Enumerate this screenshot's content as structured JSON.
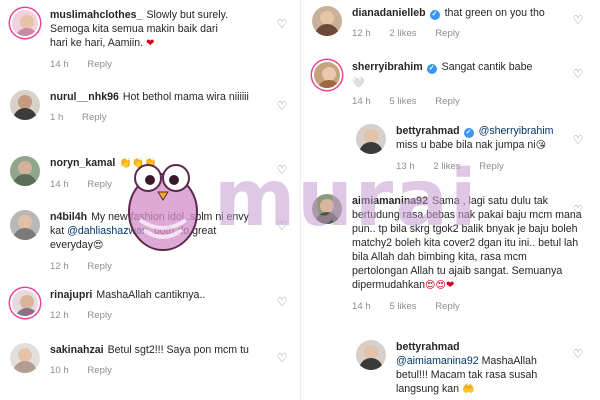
{
  "left_comments": [
    {
      "username": "muslimahclothes_",
      "text": "Slowly but surely. Semoga kita semua makin baik dari hari ke hari, Aamiin.",
      "emoji": "❤",
      "time": "14 h",
      "reply_label": "Reply"
    },
    {
      "username": "nurul__nhk96",
      "text": "Hot bethol mama wira niiiiii",
      "time": "1 h",
      "reply_label": "Reply"
    },
    {
      "username": "noryn_kamal",
      "text": "",
      "emoji": "👏👏👏",
      "time": "14 h",
      "reply_label": "Reply"
    },
    {
      "username": "n4bil4h",
      "text_before": "My new fashion idol..sblm ni envy kat",
      "mention": "@dahliashazwan",
      "text_after": "..both do great everyday",
      "emoji": "😍",
      "time": "12 h",
      "reply_label": "Reply"
    },
    {
      "username": "rinajupri",
      "text": "MashaAllah cantiknya..",
      "time": "12 h",
      "reply_label": "Reply"
    },
    {
      "username": "sakinahzai",
      "text": "Betul sgt2!!! Saya pon mcm tu",
      "time": "10 h",
      "reply_label": "Reply"
    }
  ],
  "right_comments": [
    {
      "username": "dianadanielleb",
      "verified": true,
      "text": "that green on you tho",
      "time": "12 h",
      "likes": "2 likes",
      "reply_label": "Reply"
    },
    {
      "username": "sherryibrahim",
      "verified": true,
      "text": "Sangat cantik babe",
      "emoji": "🤍",
      "time": "14 h",
      "likes": "5 likes",
      "reply_label": "Reply"
    },
    {
      "username": "bettyrahmad",
      "verified": true,
      "mention": "@sherryibrahim",
      "text": "miss u babe bila nak jumpa ni",
      "emoji": "😘",
      "time": "13 h",
      "likes": "2 likes",
      "reply_label": "Reply"
    },
    {
      "username": "aimiamanina92",
      "text": "Sama , lagi satu dulu tak bertudung rasa bebas nak pakai baju mcm mana pun.. tp bila skrg tgok2 balik bnyak je baju boleh matchy2 boleh kita cover2 dgan itu ini.. betul lah bila Allah dah bimbing kita, rasa mcm pertolongan Allah tu ajaib sangat. Semuanya dipermudahkan",
      "emoji": "😍😍❤",
      "time": "14 h",
      "likes": "5 likes",
      "reply_label": "Reply"
    },
    {
      "username": "bettyrahmad",
      "verified": false,
      "mention": "@aimiamanina92",
      "text": "MashaAllah betul!!! Macam tak rasa susah langsung kan",
      "emoji": "🤲",
      "time": "",
      "reply_label": ""
    }
  ],
  "watermark": {
    "text": "murai"
  },
  "icons": {
    "like": "heart-outline-icon",
    "verified": "verified-badge-icon"
  },
  "colors": {
    "mention": "#00376b",
    "meta": "#8e8e8e",
    "verified": "#3897f0",
    "story_ring": "#e84393"
  }
}
